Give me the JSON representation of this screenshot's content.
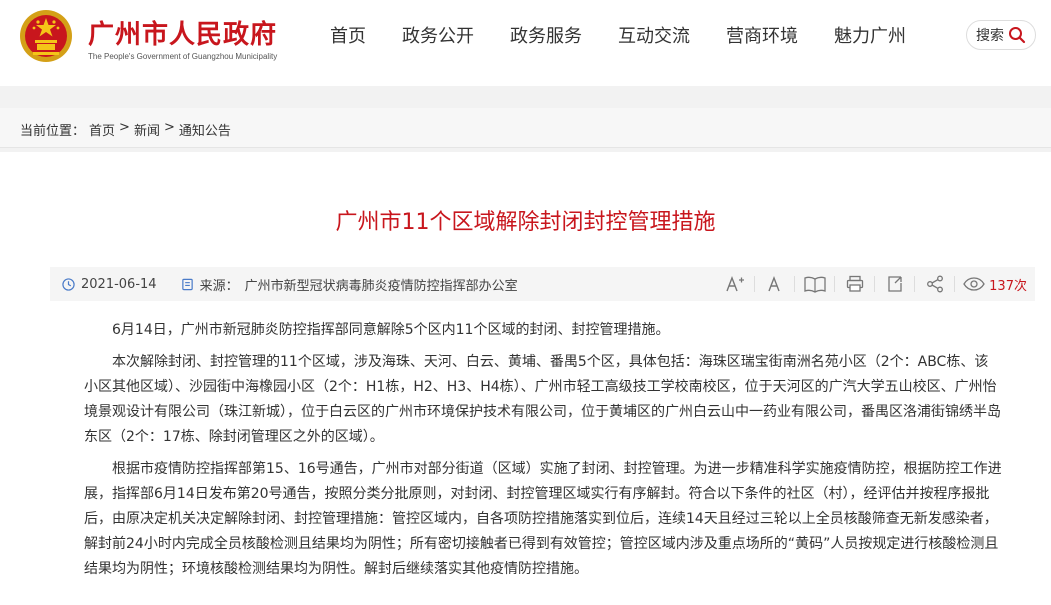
{
  "header": {
    "site_title": "广州市人民政府",
    "site_subtitle": "The People's Government of Guangzhou Municipality",
    "nav": [
      "首页",
      "政务公开",
      "政务服务",
      "互动交流",
      "营商环境",
      "魅力广州"
    ],
    "search_label": "搜索",
    "brand_color": "#c8161d"
  },
  "breadcrumb": {
    "prefix": "当前位置：",
    "items": [
      "首页",
      "新闻",
      "通知公告"
    ],
    "separator": ">"
  },
  "article": {
    "title": "广州市11个区域解除封闭封控管理措施",
    "date": "2021-06-14",
    "source_label": "来源：",
    "source": "广州市新型冠状病毒肺炎疫情防控指挥部办公室",
    "views_count": "137",
    "views_unit": "次",
    "paragraphs": [
      "6月14日，广州市新冠肺炎防控指挥部同意解除5个区内11个区域的封闭、封控管理措施。",
      "本次解除封闭、封控管理的11个区域，涉及海珠、天河、白云、黄埔、番禺5个区，具体包括：海珠区瑞宝街南洲名苑小区（2个：ABC栋、该小区其他区域）、沙园街中海橡园小区（2个：H1栋，H2、H3、H4栋）、广州市轻工高级技工学校南校区，位于天河区的广汽大学五山校区、广州怡境景观设计有限公司（珠江新城），位于白云区的广州市环境保护技术有限公司，位于黄埔区的广州白云山中一药业有限公司，番禺区洛浦街锦绣半岛东区（2个：17栋、除封闭管理区之外的区域）。",
      "根据市疫情防控指挥部第15、16号通告，广州市对部分街道（区域）实施了封闭、封控管理。为进一步精准科学实施疫情防控，根据防控工作进展，指挥部6月14日发布第20号通告，按照分类分批原则，对封闭、封控管理区域实行有序解封。符合以下条件的社区（村），经评估并按程序报批后，由原决定机关决定解除封闭、封控管理措施：管控区域内，自各项防控措施落实到位后，连续14天且经过三轮以上全员核酸筛查无新发感染者，解封前24小时内完成全员核酸检测且结果均为阴性；所有密切接触者已得到有效管控；管控区域内涉及重点场所的“黄码”人员按规定进行核酸检测且结果均为阴性；环境核酸检测结果均为阴性。解封后继续落实其他疫情防控措施。"
    ]
  },
  "tools": {
    "font_increase_icon": "font-increase-icon",
    "font_decrease_icon": "font-decrease-icon",
    "print_icon": "print-icon",
    "share_icon": "share-icon"
  }
}
